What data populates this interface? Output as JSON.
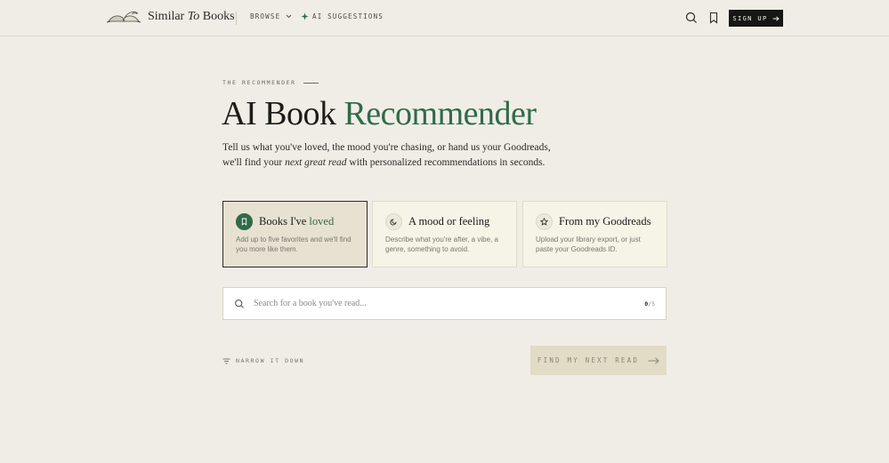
{
  "header": {
    "logo": {
      "pre": "Similar ",
      "italic": "To",
      "post": " Books"
    },
    "nav": {
      "browse": "BROWSE",
      "ai": "AI SUGGESTIONS"
    },
    "signup": "SIGN UP"
  },
  "hero": {
    "eyebrow": "THE RECOMMENDER",
    "title_main": "AI Book ",
    "title_accent": "Recommender",
    "subtitle": {
      "line1": "Tell us what you've loved, the mood you're chasing, or hand us your Goodreads,",
      "line2_pre": "we'll find your ",
      "line2_italic": "next great read",
      "line2_post": " with personalized recommendations in seconds."
    }
  },
  "modes": [
    {
      "title": "Books I've ",
      "title_accent": "loved",
      "desc": "Add up to five favorites and we'll find you more like them.",
      "active": true,
      "icon": "bookmark-icon"
    },
    {
      "title": "A mood or feeling",
      "title_accent": "",
      "desc": "Describe what you're after, a vibe, a genre, something to avoid.",
      "active": false,
      "icon": "moon-icon"
    },
    {
      "title": "From my Goodreads",
      "title_accent": "",
      "desc": "Upload your library export, or just paste your Goodreads ID.",
      "active": false,
      "icon": "star-icon"
    }
  ],
  "search": {
    "placeholder": "Search for a book you've read...",
    "count": "0",
    "max": "/5"
  },
  "actions": {
    "narrow": "NARROW IT DOWN",
    "find": "FIND MY NEXT READ"
  },
  "colors": {
    "accent": "#2f6b47",
    "background": "#f0ede6",
    "button_disabled": "#e2dbc6"
  }
}
